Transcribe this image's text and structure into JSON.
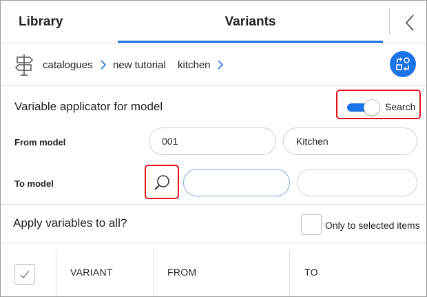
{
  "tabs": {
    "library": "Library",
    "variants": "Variants"
  },
  "breadcrumb": {
    "items": [
      "catalogues",
      "new tutorial",
      "kitchen"
    ]
  },
  "applicator": {
    "title": "Variable applicator for model",
    "toggle_label": "Search",
    "toggle_on": true,
    "from_label": "From model",
    "from_code": "001",
    "from_name": "Kitchen",
    "to_label": "To model",
    "to_code": "",
    "to_name": ""
  },
  "apply": {
    "label": "Apply variables to all?",
    "only_selected_label": "Only to selected items",
    "only_selected_checked": false
  },
  "table": {
    "select_all_checked": true,
    "columns": [
      "VARIANT",
      "FROM",
      "TO"
    ]
  },
  "colors": {
    "accent": "#1a73e8",
    "highlight": "#e0101b"
  },
  "icons": {
    "back": "chevron-left-icon",
    "breadcrumb_start": "signpost-icon",
    "swap": "swap-icon",
    "search": "magnifier-icon"
  }
}
